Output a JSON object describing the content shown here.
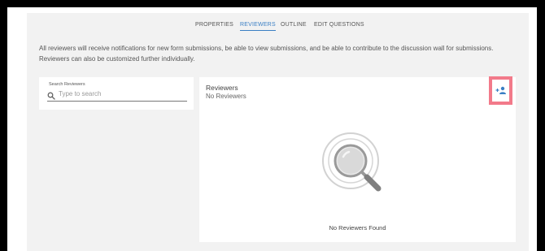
{
  "tabs": [
    {
      "label": "PROPERTIES",
      "active": false
    },
    {
      "label": "REVIEWERS",
      "active": true
    },
    {
      "label": "OUTLINE",
      "active": false
    },
    {
      "label": "EDIT QUESTIONS",
      "active": false
    }
  ],
  "description": {
    "line1": "All reviewers will receive notifications for new form submissions, be able to view submissions, and be able to contribute to the discussion wall for submissions.",
    "line2": "Reviewers can also be customized further individually."
  },
  "search": {
    "label": "Search Reviewers",
    "placeholder": "Type to search",
    "value": "",
    "icon": "search-icon"
  },
  "reviewers": {
    "title": "Reviewers",
    "subtitle": "No Reviewers",
    "add_icon": "add-person-icon",
    "empty_icon": "magnifying-glass-icon",
    "empty_text": "No Reviewers Found"
  },
  "colors": {
    "accent": "#3a7fc4",
    "highlight": "#f27a8a",
    "panel": "#f2f2f2"
  }
}
